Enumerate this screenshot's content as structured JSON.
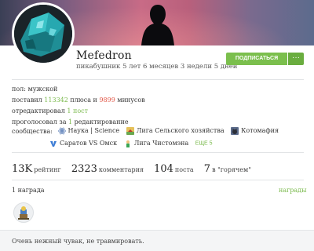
{
  "profile": {
    "username": "Mefedron",
    "tenure": "пикабушник 5 лет 6 месяцев 3 недели 5 дней",
    "subscribe_label": "ПОДПИСАТЬСЯ",
    "more_label": "···"
  },
  "info": {
    "gender": "пол: мужской",
    "voted_prefix": "поставил ",
    "pluses": "113342",
    "pluses_mid": " плюса и ",
    "minuses": "9899",
    "minuses_suffix": " минусов",
    "edited_prefix": "отредактировал ",
    "edited_link": "1 пост",
    "polled_prefix": "проголосовал за ",
    "polled_link": "1",
    "polled_suffix": " редактирование",
    "communities_label": "сообщества:",
    "communities": [
      {
        "name": "Наука | Science",
        "icon": "atom-icon"
      },
      {
        "name": "Лига Сельского хозяйства",
        "icon": "farm-icon"
      },
      {
        "name": "Котомафия",
        "icon": "cat-icon"
      },
      {
        "name": "Саратов VS Омск",
        "icon": "versus-icon"
      },
      {
        "name": "Лига Чистомэна",
        "icon": "cleaner-icon"
      }
    ],
    "more_communities": "ЕЩЕ 5"
  },
  "stats": [
    {
      "value": "13K",
      "label": "рейтинг"
    },
    {
      "value": "2323",
      "label": "комментария"
    },
    {
      "value": "104",
      "label": "поста"
    },
    {
      "value": "7",
      "label": "в \"горячем\""
    }
  ],
  "awards": {
    "count_label": "1 награда",
    "link_label": "награды",
    "badge_icon": "award-icon"
  },
  "about": "Очень нежный чувак, не травмировать.",
  "colors": {
    "accent_green": "#79b94b",
    "minus_red": "#e25a4a",
    "subscribe_bg": "#7bbf4d"
  }
}
